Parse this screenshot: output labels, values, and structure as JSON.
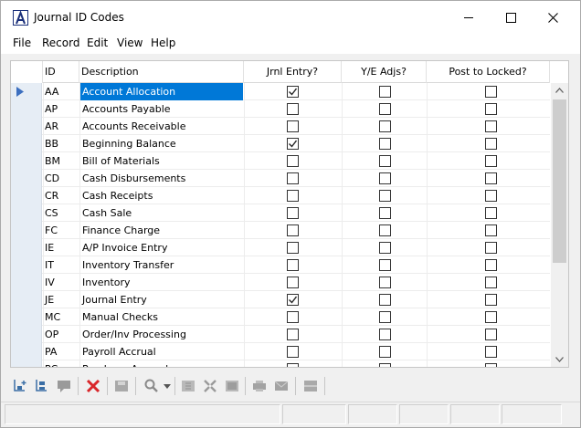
{
  "window": {
    "title": "Journal ID Codes"
  },
  "menu": {
    "items": [
      "File",
      "Record",
      "Edit",
      "View",
      "Help"
    ]
  },
  "grid": {
    "columns": {
      "id": "ID",
      "description": "Description",
      "jrnl_entry": "Jrnl Entry?",
      "ye_adjs": "Y/E Adjs?",
      "post_locked": "Post to Locked?"
    },
    "rows": [
      {
        "id": "AA",
        "description": "Account Allocation",
        "jrnl_entry": true,
        "ye_adjs": false,
        "post_locked": false
      },
      {
        "id": "AP",
        "description": "Accounts Payable",
        "jrnl_entry": false,
        "ye_adjs": false,
        "post_locked": false
      },
      {
        "id": "AR",
        "description": "Accounts Receivable",
        "jrnl_entry": false,
        "ye_adjs": false,
        "post_locked": false
      },
      {
        "id": "BB",
        "description": "Beginning Balance",
        "jrnl_entry": true,
        "ye_adjs": false,
        "post_locked": false
      },
      {
        "id": "BM",
        "description": "Bill of Materials",
        "jrnl_entry": false,
        "ye_adjs": false,
        "post_locked": false
      },
      {
        "id": "CD",
        "description": "Cash Disbursements",
        "jrnl_entry": false,
        "ye_adjs": false,
        "post_locked": false
      },
      {
        "id": "CR",
        "description": "Cash Receipts",
        "jrnl_entry": false,
        "ye_adjs": false,
        "post_locked": false
      },
      {
        "id": "CS",
        "description": "Cash Sale",
        "jrnl_entry": false,
        "ye_adjs": false,
        "post_locked": false
      },
      {
        "id": "FC",
        "description": "Finance Charge",
        "jrnl_entry": false,
        "ye_adjs": false,
        "post_locked": false
      },
      {
        "id": "IE",
        "description": "A/P Invoice Entry",
        "jrnl_entry": false,
        "ye_adjs": false,
        "post_locked": false
      },
      {
        "id": "IT",
        "description": "Inventory Transfer",
        "jrnl_entry": false,
        "ye_adjs": false,
        "post_locked": false
      },
      {
        "id": "IV",
        "description": "Inventory",
        "jrnl_entry": false,
        "ye_adjs": false,
        "post_locked": false
      },
      {
        "id": "JE",
        "description": "Journal Entry",
        "jrnl_entry": true,
        "ye_adjs": false,
        "post_locked": false
      },
      {
        "id": "MC",
        "description": "Manual Checks",
        "jrnl_entry": false,
        "ye_adjs": false,
        "post_locked": false
      },
      {
        "id": "OP",
        "description": "Order/Inv Processing",
        "jrnl_entry": false,
        "ye_adjs": false,
        "post_locked": false
      },
      {
        "id": "PA",
        "description": "Payroll Accrual",
        "jrnl_entry": false,
        "ye_adjs": false,
        "post_locked": false
      },
      {
        "id": "PC",
        "description": "Purchase Accrual",
        "jrnl_entry": false,
        "ye_adjs": false,
        "post_locked": false
      }
    ],
    "selected_row": 0
  },
  "toolbar": {
    "icons": [
      "new-record-icon",
      "copy-record-icon",
      "comment-icon",
      "delete-icon",
      "save-icon",
      "search-icon",
      "first-record-icon",
      "grid-view-icon",
      "form-view-icon",
      "print-icon",
      "email-icon",
      "layout-icon"
    ]
  },
  "colors": {
    "selection": "#0078d7",
    "delete": "#d9262a",
    "row_marker": "#3c6fbf"
  }
}
